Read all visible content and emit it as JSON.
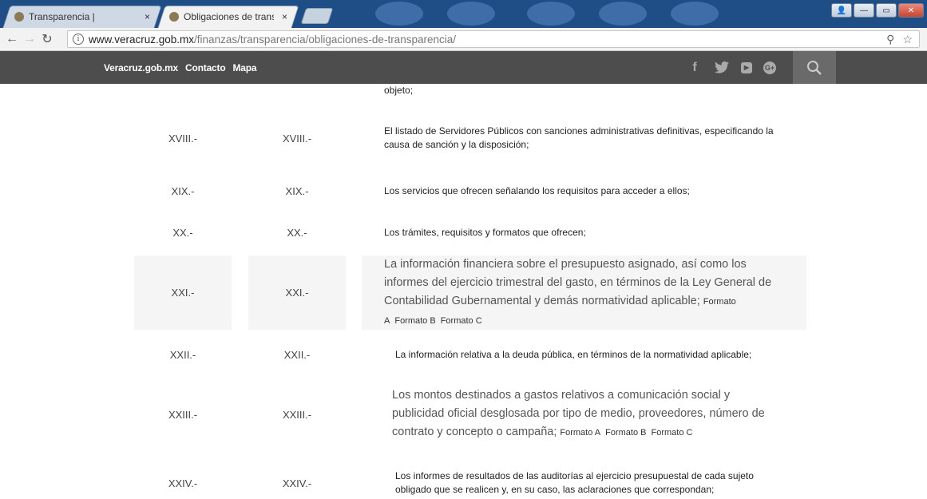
{
  "browser": {
    "tabs": [
      {
        "title": "Transparencia |",
        "close": "×"
      },
      {
        "title": "Obligaciones de transpar",
        "close": "×"
      }
    ],
    "url_host": "www.veracruz.gob.mx",
    "url_path": "/finanzas/transparencia/obligaciones-de-transparencia/"
  },
  "nav": {
    "links": [
      "Veracruz.gob.mx",
      "Contacto",
      "Mapa"
    ]
  },
  "top_fragment": "objeto;",
  "rows": [
    {
      "n1": "XVIII.-",
      "n2": "XVIII.-",
      "text": "El listado de Servidores Públicos con sanciones administrativas definitivas, especificando la causa de sanción y la disposición;"
    },
    {
      "n1": "XIX.-",
      "n2": "XIX.-",
      "text": "Los servicios que ofrecen señalando los requisitos para acceder a ellos;"
    },
    {
      "n1": "XX.-",
      "n2": "XX.-",
      "text": "Los trámites, requisitos y formatos que ofrecen;"
    },
    {
      "n1": "XXI.-",
      "n2": "XXI.-",
      "text": "La información financiera sobre el presupuesto asignado, así como los informes del ejercicio trimestral del gasto, en términos de la Ley General de Contabilidad Gubernamental y demás normatividad aplicable;",
      "formats": [
        "Formato A",
        "Formato B",
        "Formato C"
      ]
    },
    {
      "n1": "XXII.-",
      "n2": "XXII.-",
      "text": "La información relativa a la deuda pública, en términos de la normatividad aplicable;"
    },
    {
      "n1": "XXIII.-",
      "n2": "XXIII.-",
      "text": "Los montos destinados a gastos relativos a comunicación social y publicidad oficial desglosada por tipo de medio, proveedores, número de contrato y concepto o campaña;",
      "formats": [
        "Formato A",
        "Formato B",
        "Formato C"
      ]
    },
    {
      "n1": "XXIV.-",
      "n2": "XXIV.-",
      "text": "Los informes de resultados de las auditorías al ejercicio presupuestal de cada sujeto obligado que se realicen y, en su caso, las aclaraciones que correspondan;"
    }
  ]
}
